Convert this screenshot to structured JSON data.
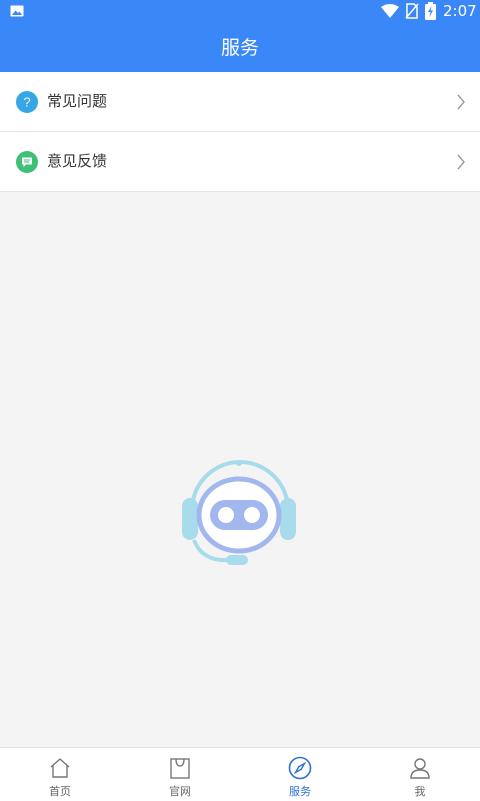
{
  "status_bar": {
    "time": "2:07",
    "icons": [
      "image-icon",
      "wifi-icon",
      "no-sim-icon",
      "battery-charging-icon"
    ]
  },
  "header": {
    "title": "服务"
  },
  "menu": {
    "items": [
      {
        "label": "常见问题",
        "icon": "question-icon",
        "icon_color": "#35a6e6"
      },
      {
        "label": "意见反馈",
        "icon": "feedback-chat-icon",
        "icon_color": "#3fbf78"
      }
    ]
  },
  "mascot": {
    "icon": "robot-headset-icon"
  },
  "tabbar": {
    "active_color": "#2f6fd6",
    "tabs": [
      {
        "label": "首页",
        "icon": "home-icon"
      },
      {
        "label": "官网",
        "icon": "shopping-bag-icon"
      },
      {
        "label": "服务",
        "icon": "compass-icon",
        "active": true
      },
      {
        "label": "我",
        "icon": "person-icon"
      }
    ]
  }
}
